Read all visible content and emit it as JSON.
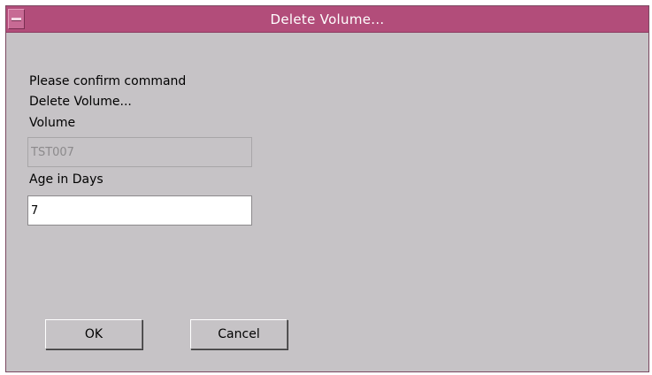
{
  "dialog": {
    "title": "Delete Volume..."
  },
  "content": {
    "prompt": "Please confirm command",
    "command": "Delete Volume...",
    "volume_label": "Volume",
    "volume_value": "TST007",
    "age_label": "Age in Days",
    "age_value": "7"
  },
  "buttons": {
    "ok_label": "OK",
    "cancel_label": "Cancel"
  },
  "colors": {
    "titlebar": "#b24d7a",
    "window_bg": "#c6c3c6"
  }
}
